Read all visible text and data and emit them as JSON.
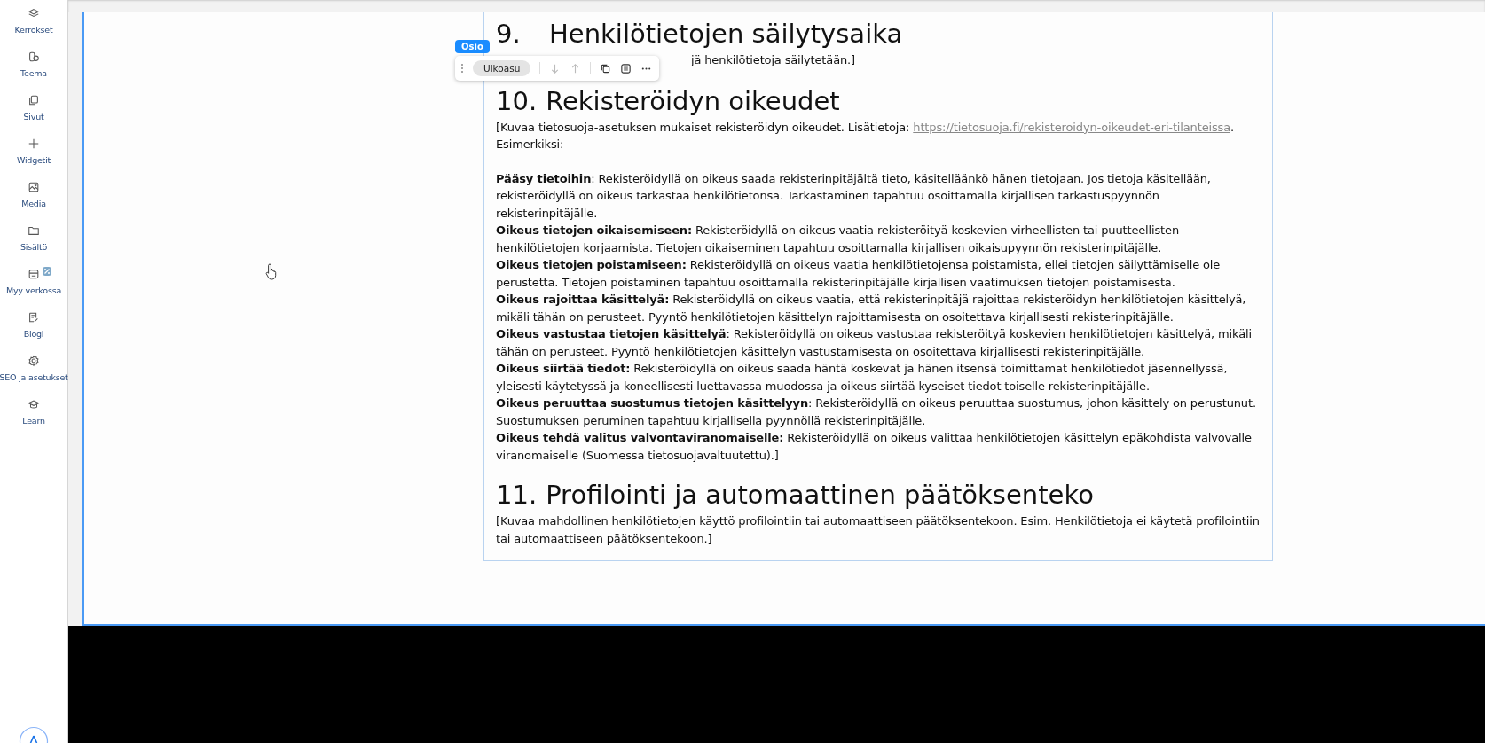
{
  "sidebar": {
    "items": [
      {
        "label": "Kerrokset",
        "badge": false
      },
      {
        "label": "Teema",
        "badge": false
      },
      {
        "label": "Sivut",
        "badge": false
      },
      {
        "label": "Widgetit",
        "badge": false
      },
      {
        "label": "Media",
        "badge": false
      },
      {
        "label": "Sisältö",
        "badge": false
      },
      {
        "label": "Myy verkossa",
        "badge": true
      },
      {
        "label": "Blogi",
        "badge": false
      },
      {
        "label": "SEO ja asetukset",
        "badge": false
      },
      {
        "label": "Learn",
        "badge": false
      }
    ]
  },
  "section_badge": "Osio",
  "toolbar": {
    "layout_button": "Ulkoasu"
  },
  "sections": [
    {
      "number": "9.",
      "title": "Henkilötietojen säilytysaika",
      "paragraphs": [
        {
          "text": "jä henkilötietoja säilytetään.]",
          "covered": true
        }
      ]
    },
    {
      "number": "10.",
      "title": "Rekisteröidyn oikeudet",
      "intro": {
        "before": "[Kuvaa tietosuoja-asetuksen mukaiset rekisteröidyn oikeudet. Lisätietoja: ",
        "link": "https://tietosuoja.fi/rekisteroidyn-oikeudet-eri-tilanteissa",
        "after": ". Esimerkiksi:"
      },
      "paragraphs": [
        {
          "text": "**Pääsy tietoihin**: Rekisteröidyllä on oikeus saada rekisterinpitäjältä tieto, käsitelläänkö hänen tietojaan. Jos tietoja käsitellään, rekisteröidyllä on oikeus tarkastaa henkilötietonsa. Tarkastaminen tapahtuu osoittamalla kirjallisen tarkastuspyynnön rekisterinpitäjälle."
        },
        {
          "text": "**Oikeus tietojen oikaisemiseen:** Rekisteröidyllä on oikeus vaatia rekisteröityä koskevien virheellisten tai puutteellisten henkilötietojen korjaamista. Tietojen oikaiseminen tapahtuu osoittamalla kirjallisen oikaisupyynnön rekisterinpitäjälle."
        },
        {
          "text": "**Oikeus tietojen poistamiseen:** Rekisteröidyllä on oikeus vaatia henkilötietojensa poistamista, ellei tietojen säilyttämiselle ole perustetta. Tietojen poistaminen tapahtuu osoittamalla rekisterinpitäjälle kirjallisen vaatimuksen tietojen poistamisesta."
        },
        {
          "text": "**Oikeus rajoittaa käsittelyä:** Rekisteröidyllä on oikeus vaatia, että rekisterinpitäjä rajoittaa rekisteröidyn henkilötietojen käsittelyä, mikäli tähän on perusteet. Pyyntö henkilötietojen käsittelyn rajoittamisesta on osoitettava kirjallisesti rekisterinpitäjälle."
        },
        {
          "text": "**Oikeus vastustaa tietojen käsittelyä**: Rekisteröidyllä on oikeus vastustaa rekisteröityä koskevien henkilötietojen käsittelyä, mikäli tähän on perusteet. Pyyntö henkilötietojen käsittelyn vastustamisesta on osoitettava kirjallisesti rekisterinpitäjälle."
        },
        {
          "text": "**Oikeus siirtää tiedot:** Rekisteröidyllä on oikeus saada häntä koskevat ja hänen itsensä toimittamat henkilötiedot jäsennellyssä, yleisesti käytetyssä ja koneellisesti luettavassa muodossa ja oikeus siirtää kyseiset tiedot toiselle rekisterinpitäjälle."
        },
        {
          "text": "**Oikeus peruuttaa suostumus tietojen käsittelyyn**: Rekisteröidyllä on oikeus peruuttaa suostumus, johon käsittely on perustunut. Suostumuksen peruminen tapahtuu kirjallisella pyynnöllä rekisterinpitäjälle."
        },
        {
          "text": "**Oikeus tehdä valitus valvontaviranomaiselle:** Rekisteröidyllä on oikeus valittaa henkilötietojen käsittelyn epäkohdista valvovalle viranomaiselle (Suomessa tietosuojavaltuutettu).]"
        }
      ]
    },
    {
      "number": "11.",
      "title": "Profilointi ja automaattinen päätöksenteko",
      "paragraphs": [
        {
          "text": "[Kuvaa mahdollinen henkilötietojen käyttö profilointiin tai automaattiseen päätöksentekoon. Esim. Henkilötietoja ei käytetä profilointiin tai automaattiseen päätöksentekoon.]"
        }
      ]
    }
  ]
}
